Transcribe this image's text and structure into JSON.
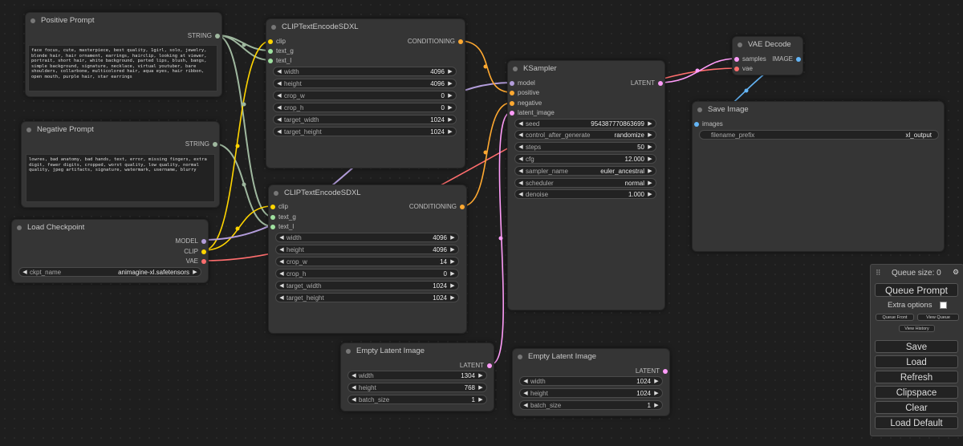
{
  "colors": {
    "canvas_bg": "#1e1e1e",
    "node_bg": "#353535",
    "clip_link": "#ffd500",
    "conditioning_link": "#ffa931",
    "model_link": "#b39ddb",
    "vae_link": "#ff6e6e",
    "latent_link": "#ff9cf9",
    "image_link": "#64b5f6",
    "string_link": "#9fb89f"
  },
  "nodes": {
    "positive_prompt": {
      "title": "Positive Prompt",
      "output": "STRING",
      "text": "face focus, cute, masterpiece, best quality, 1girl, solo, jewelry, blonde hair, hair ornament, earrings, hairclip, looking at viewer, portrait, short hair, white background, parted lips, blush, bangs, simple background, signature, necklace, virtual youtuber, bare shoulders, collarbone, multicolored hair, aqua eyes, hair ribbon, open mouth, purple hair, star earrings"
    },
    "negative_prompt": {
      "title": "Negative Prompt",
      "output": "STRING",
      "text": "lowres, bad anatomy, bad hands, text, error, missing fingers, extra digit, fewer digits, cropped, worst quality, low quality, normal quality, jpeg artifacts, signature, watermark, username, blurry"
    },
    "load_checkpoint": {
      "title": "Load Checkpoint",
      "outputs": [
        "MODEL",
        "CLIP",
        "VAE"
      ],
      "ckpt_label": "ckpt_name",
      "ckpt_value": "animagine-xl.safetensors"
    },
    "clip_encode_1": {
      "title": "CLIPTextEncodeSDXL",
      "inputs": [
        "clip",
        "text_g",
        "text_l"
      ],
      "output": "CONDITIONING",
      "widgets": [
        {
          "label": "width",
          "value": "4096"
        },
        {
          "label": "height",
          "value": "4096"
        },
        {
          "label": "crop_w",
          "value": "0"
        },
        {
          "label": "crop_h",
          "value": "0"
        },
        {
          "label": "target_width",
          "value": "1024"
        },
        {
          "label": "target_height",
          "value": "1024"
        }
      ]
    },
    "clip_encode_2": {
      "title": "CLIPTextEncodeSDXL",
      "inputs": [
        "clip",
        "text_g",
        "text_l"
      ],
      "output": "CONDITIONING",
      "widgets": [
        {
          "label": "width",
          "value": "4096"
        },
        {
          "label": "height",
          "value": "4096"
        },
        {
          "label": "crop_w",
          "value": "14"
        },
        {
          "label": "crop_h",
          "value": "0"
        },
        {
          "label": "target_width",
          "value": "1024"
        },
        {
          "label": "target_height",
          "value": "1024"
        }
      ]
    },
    "ksampler": {
      "title": "KSampler",
      "inputs": [
        "model",
        "positive",
        "negative",
        "latent_image"
      ],
      "output": "LATENT",
      "widgets": [
        {
          "label": "seed",
          "value": "954387770863699"
        },
        {
          "label": "control_after_generate",
          "value": "randomize"
        },
        {
          "label": "steps",
          "value": "50"
        },
        {
          "label": "cfg",
          "value": "12.000"
        },
        {
          "label": "sampler_name",
          "value": "euler_ancestral"
        },
        {
          "label": "scheduler",
          "value": "normal"
        },
        {
          "label": "denoise",
          "value": "1.000"
        }
      ]
    },
    "vae_decode": {
      "title": "VAE Decode",
      "inputs": [
        "samples",
        "vae"
      ],
      "output": "IMAGE"
    },
    "save_image": {
      "title": "Save Image",
      "input": "images",
      "prefix_label": "filename_prefix",
      "prefix_value": "xl_output"
    },
    "empty_latent_1": {
      "title": "Empty Latent Image",
      "output": "LATENT",
      "widgets": [
        {
          "label": "width",
          "value": "1304"
        },
        {
          "label": "height",
          "value": "768"
        },
        {
          "label": "batch_size",
          "value": "1"
        }
      ]
    },
    "empty_latent_2": {
      "title": "Empty Latent Image",
      "output": "LATENT",
      "widgets": [
        {
          "label": "width",
          "value": "1024"
        },
        {
          "label": "height",
          "value": "1024"
        },
        {
          "label": "batch_size",
          "value": "1"
        }
      ]
    }
  },
  "menu": {
    "queue_size": "Queue size: 0",
    "queue_prompt": "Queue Prompt",
    "extra_options": "Extra options",
    "queue_front": "Queue Front",
    "view_queue": "View Queue",
    "view_history": "View History",
    "save": "Save",
    "load": "Load",
    "refresh": "Refresh",
    "clipspace": "Clipspace",
    "clear": "Clear",
    "load_default": "Load Default"
  }
}
